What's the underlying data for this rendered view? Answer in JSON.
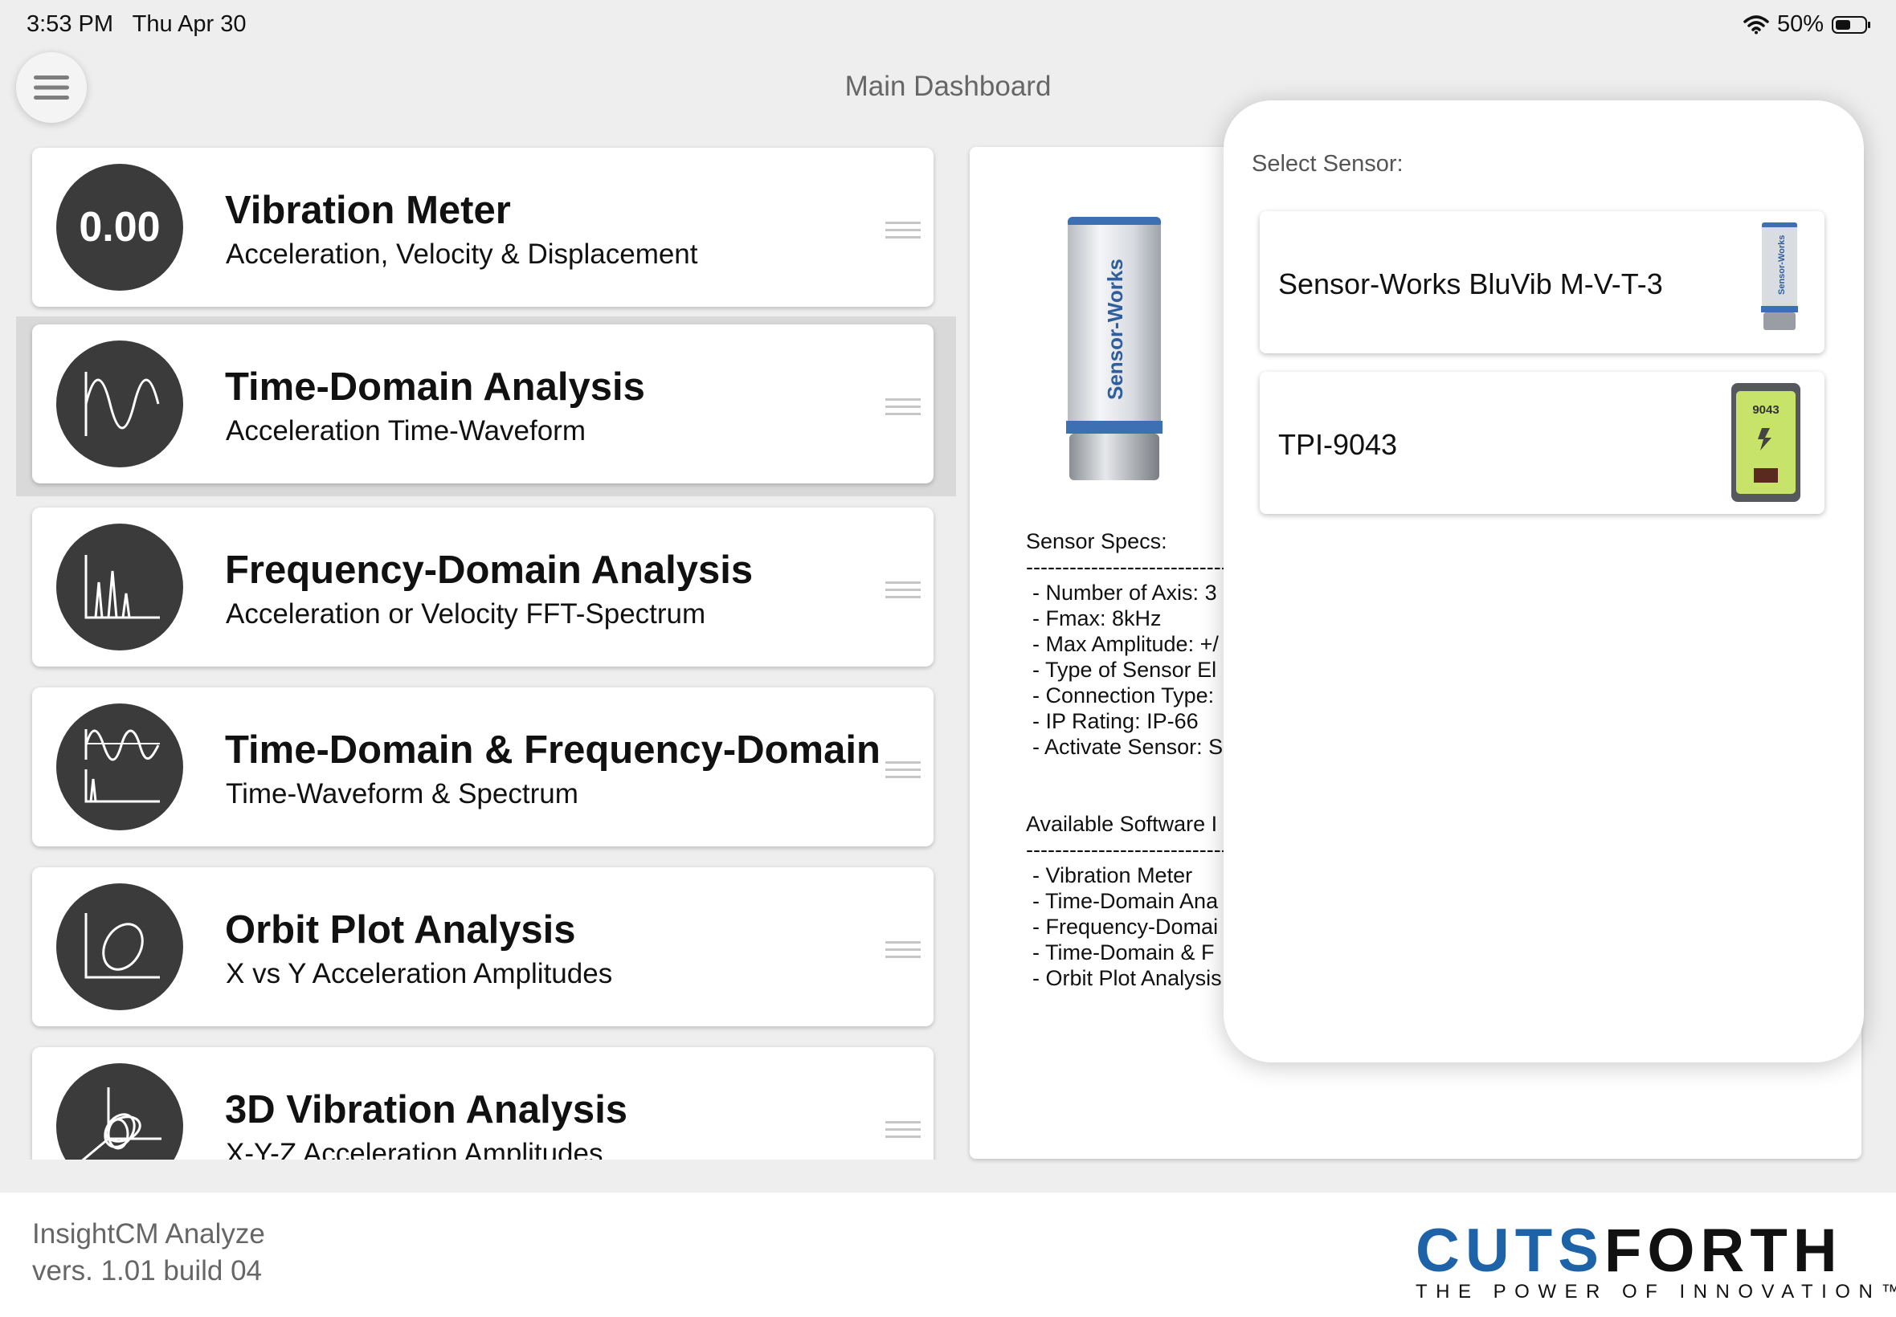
{
  "status_bar": {
    "time": "3:53 PM",
    "date": "Thu Apr 30",
    "battery": "50%"
  },
  "header": {
    "title": "Main Dashboard"
  },
  "analyses": [
    {
      "icon": "value-readout",
      "icon_text": "0.00",
      "title": "Vibration Meter",
      "subtitle": "Acceleration, Velocity & Displacement"
    },
    {
      "icon": "waveform-icon",
      "title": "Time-Domain Analysis",
      "subtitle": "Acceleration Time-Waveform"
    },
    {
      "icon": "spectrum-icon",
      "title": "Frequency-Domain Analysis",
      "subtitle": "Acceleration or Velocity FFT-Spectrum"
    },
    {
      "icon": "waveform-spectrum-icon",
      "title": "Time-Domain & Frequency-Domain",
      "subtitle": "Time-Waveform & Spectrum"
    },
    {
      "icon": "orbit-icon",
      "title": "Orbit Plot Analysis",
      "subtitle": "X vs Y Acceleration Amplitudes"
    },
    {
      "icon": "3d-vibration-icon",
      "title": "3D Vibration Analysis",
      "subtitle": "X-Y-Z Acceleration Amplitudes"
    }
  ],
  "detail": {
    "sensor_brand_text": "Sensor-Works",
    "specs_title": "Sensor Specs:",
    "specs_divider": "------------------------------",
    "specs": [
      "- Number of Axis: 3",
      "- Fmax: 8kHz",
      "- Max Amplitude: +/",
      "- Type of Sensor El",
      "- Connection Type:",
      "- IP Rating: IP-66",
      "- Activate Sensor: S"
    ],
    "software_title": "Available Software I",
    "software_divider": "------------------------------",
    "software": [
      "- Vibration Meter",
      "- Time-Domain Ana",
      "- Frequency-Domai",
      "- Time-Domain & F",
      "- Orbit Plot Analysis"
    ]
  },
  "sensor_picker": {
    "title": "Select Sensor:",
    "options": [
      {
        "label": "Sensor-Works BluVib M-V-T-3",
        "thumb_text": "Sensor-Works"
      },
      {
        "label": "TPI-9043",
        "thumb_text": "9043"
      }
    ]
  },
  "footer": {
    "app_name": "InsightCM Analyze",
    "version": "vers. 1.01 build 04",
    "brand_part1": "CUTS",
    "brand_part2": "FORTH",
    "tagline": "THE POWER OF INNOVATION™"
  },
  "colors": {
    "accent": "#1e63a8",
    "icon_circle": "#3b3b3b",
    "tpi_device": "#c8e36a"
  }
}
